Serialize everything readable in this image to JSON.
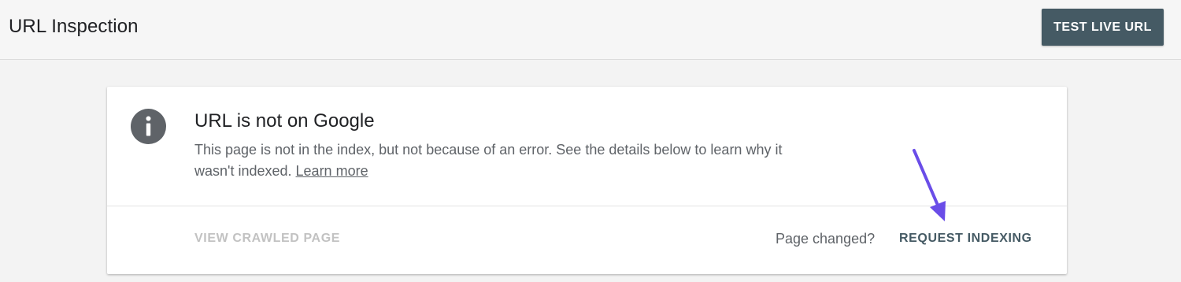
{
  "header": {
    "title": "URL Inspection",
    "test_live_url_label": "TEST LIVE URL",
    "button_color": "#455a64"
  },
  "card": {
    "icon": "info-icon",
    "title": "URL is not on Google",
    "description_part1": "This page is not in the index, but not because of an error. See the details below to learn why it wasn't indexed.",
    "learn_more_label": "Learn more",
    "view_crawled_page_label": "VIEW CRAWLED PAGE",
    "page_changed_label": "Page changed?",
    "request_indexing_label": "REQUEST INDEXING"
  },
  "annotation": {
    "icon": "arrow-pointer-icon",
    "color": "#6a4de8"
  }
}
